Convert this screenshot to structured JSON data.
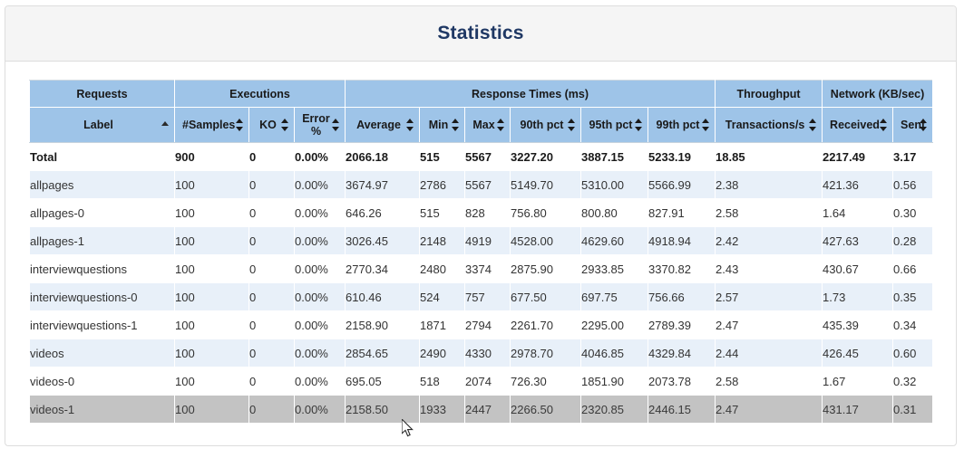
{
  "panel": {
    "title": "Statistics"
  },
  "table": {
    "group_headers": [
      {
        "label": "Requests",
        "span": 1
      },
      {
        "label": "Executions",
        "span": 3
      },
      {
        "label": "Response Times (ms)",
        "span": 6
      },
      {
        "label": "Throughput",
        "span": 1
      },
      {
        "label": "Network (KB/sec)",
        "span": 2
      }
    ],
    "columns": [
      {
        "label": "Label",
        "sort": "asc"
      },
      {
        "label": "#Samples",
        "sort": "none"
      },
      {
        "label": "KO",
        "sort": "none"
      },
      {
        "label": "Error %",
        "sort": "none"
      },
      {
        "label": "Average",
        "sort": "none"
      },
      {
        "label": "Min",
        "sort": "none"
      },
      {
        "label": "Max",
        "sort": "none"
      },
      {
        "label": "90th pct",
        "sort": "none"
      },
      {
        "label": "95th pct",
        "sort": "none"
      },
      {
        "label": "99th pct",
        "sort": "none"
      },
      {
        "label": "Transactions/s",
        "sort": "none"
      },
      {
        "label": "Received",
        "sort": "none"
      },
      {
        "label": "Sent",
        "sort": "none"
      }
    ],
    "rows": [
      {
        "state": "total",
        "cells": [
          "Total",
          "900",
          "0",
          "0.00%",
          "2066.18",
          "515",
          "5567",
          "3227.20",
          "3887.15",
          "5233.19",
          "18.85",
          "2217.49",
          "3.17"
        ]
      },
      {
        "state": "odd",
        "cells": [
          "allpages",
          "100",
          "0",
          "0.00%",
          "3674.97",
          "2786",
          "5567",
          "5149.70",
          "5310.00",
          "5566.99",
          "2.38",
          "421.36",
          "0.56"
        ]
      },
      {
        "state": "even",
        "cells": [
          "allpages-0",
          "100",
          "0",
          "0.00%",
          "646.26",
          "515",
          "828",
          "756.80",
          "800.80",
          "827.91",
          "2.58",
          "1.64",
          "0.30"
        ]
      },
      {
        "state": "odd",
        "cells": [
          "allpages-1",
          "100",
          "0",
          "0.00%",
          "3026.45",
          "2148",
          "4919",
          "4528.00",
          "4629.60",
          "4918.94",
          "2.42",
          "427.63",
          "0.28"
        ]
      },
      {
        "state": "even",
        "cells": [
          "interviewquestions",
          "100",
          "0",
          "0.00%",
          "2770.34",
          "2480",
          "3374",
          "2875.90",
          "2933.85",
          "3370.82",
          "2.43",
          "430.67",
          "0.66"
        ]
      },
      {
        "state": "odd",
        "cells": [
          "interviewquestions-0",
          "100",
          "0",
          "0.00%",
          "610.46",
          "524",
          "757",
          "677.50",
          "697.75",
          "756.66",
          "2.57",
          "1.73",
          "0.35"
        ]
      },
      {
        "state": "even",
        "cells": [
          "interviewquestions-1",
          "100",
          "0",
          "0.00%",
          "2158.90",
          "1871",
          "2794",
          "2261.70",
          "2295.00",
          "2789.39",
          "2.47",
          "435.39",
          "0.34"
        ]
      },
      {
        "state": "odd",
        "cells": [
          "videos",
          "100",
          "0",
          "0.00%",
          "2854.65",
          "2490",
          "4330",
          "2978.70",
          "4046.85",
          "4329.84",
          "2.44",
          "426.45",
          "0.60"
        ]
      },
      {
        "state": "even",
        "cells": [
          "videos-0",
          "100",
          "0",
          "0.00%",
          "695.05",
          "518",
          "2074",
          "726.30",
          "1851.90",
          "2073.78",
          "2.58",
          "1.67",
          "0.32"
        ]
      },
      {
        "state": "hovered",
        "cells": [
          "videos-1",
          "100",
          "0",
          "0.00%",
          "2158.50",
          "1933",
          "2447",
          "2266.50",
          "2320.85",
          "2446.15",
          "2.47",
          "431.17",
          "0.31"
        ]
      }
    ]
  },
  "colors": {
    "header_blue": "#9ec4e8",
    "row_alt": "#e8f0f9",
    "row_hover": "#c3c3c3",
    "title_color": "#1f3864",
    "panel_heading_bg": "#f5f5f5"
  }
}
